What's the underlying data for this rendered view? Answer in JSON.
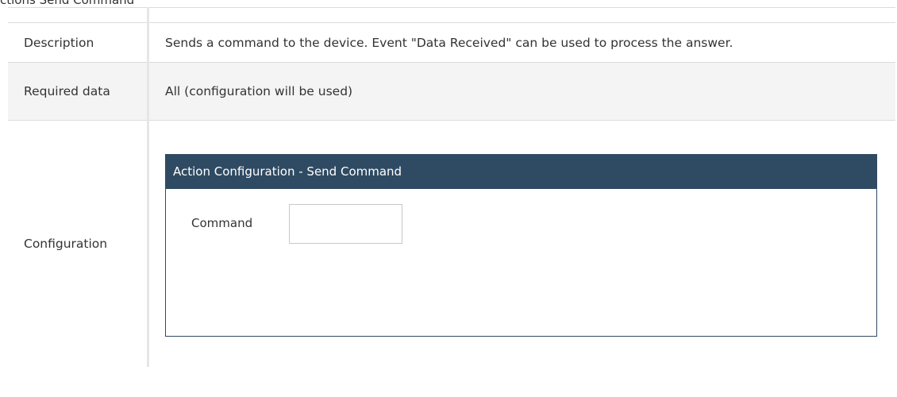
{
  "heading": "ctions Send Command",
  "rows": {
    "description": {
      "label": "Description",
      "value": "Sends a command to the device. Event \"Data Received\" can be used to process the answer."
    },
    "required": {
      "label": "Required data",
      "value": "All (configuration will be used)"
    },
    "configuration": {
      "label": "Configuration",
      "panel": {
        "title": "Action Configuration - Send Command",
        "field_label": "Command",
        "field_value": ""
      }
    }
  },
  "colors": {
    "panel_header": "#2f4b63",
    "row_alt": "#f4f4f4",
    "border": "#dcdcdc"
  }
}
